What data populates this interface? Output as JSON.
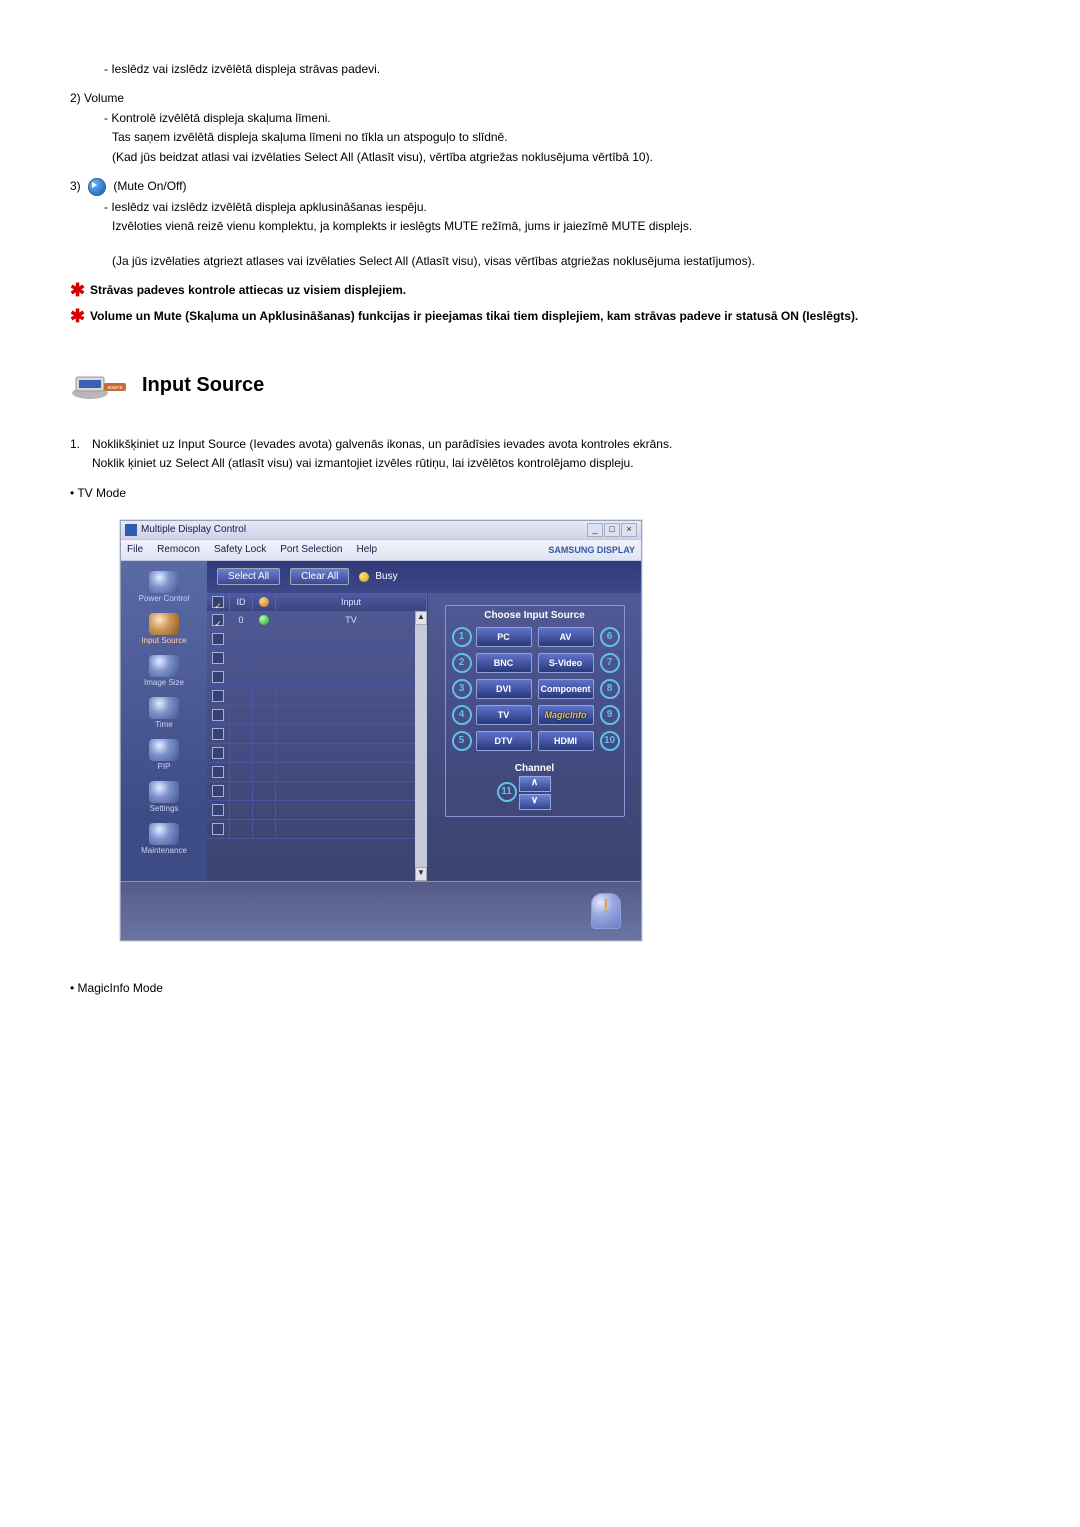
{
  "intro": {
    "power_sub": "- Ieslēdz vai izslēdz izvēlētā displeja strāvas padevi.",
    "item2_num": "2)",
    "item2_label": "Volume",
    "item2_l1": "- Kontrolē izvēlētā displeja skaļuma līmeni.",
    "item2_l2": "Tas saņem izvēlētā displeja skaļuma līmeni no tīkla un atspoguļo to slīdnē.",
    "item2_l3": "(Kad jūs beidzat atlasi vai izvēlaties Select All (Atlasīt visu), vērtība atgriežas noklusējuma vērtībā 10).",
    "item3_num": "3)",
    "item3_label": "(Mute On/Off)",
    "item3_l1": "- Ieslēdz vai izslēdz izvēlētā displeja apklusināšanas iespēju.",
    "item3_l2": "Izvēloties vienā reizē vienu komplektu, ja komplekts ir ieslēgts MUTE režīmā, jums ir jaiezīmē MUTE displejs.",
    "item3_l3": "(Ja jūs izvēlaties atgriezt atlases vai izvēlaties Select All (Atlasīt visu), visas vērtības atgriežas noklusējuma iestatījumos).",
    "star1": "Strāvas padeves kontrole attiecas uz visiem displejiem.",
    "star2": "Volume un Mute (Skaļuma un Apklusināšanas) funkcijas ir pieejamas tikai tiem displejiem, kam strāvas padeve ir statusā ON (Ieslēgts)."
  },
  "section": {
    "title": "Input Source",
    "step1_num": "1.",
    "step1_l1": "Noklikšķiniet uz Input Source (Ievades avota) galvenās ikonas, un parādīsies ievades avota kontroles ekrāns.",
    "step1_l2": "Noklik       ķiniet uz Select All (atlasīt visu) vai izmantojiet izvēles rūtiņu, lai izvēlētos kontrolējamo displeju.",
    "bullet1": "• TV Mode",
    "bullet2": "• MagicInfo Mode"
  },
  "mdc": {
    "title": "Multiple Display Control",
    "menu": {
      "file": "File",
      "remocon": "Remocon",
      "safety": "Safety Lock",
      "port": "Port Selection",
      "help": "Help"
    },
    "brand": "SAMSUNG DISPLAY",
    "sidebar": {
      "power": "Power Control",
      "input": "Input Source",
      "image": "Image Size",
      "time": "Time",
      "pip": "PIP",
      "settings": "Settings",
      "maint": "Maintenance"
    },
    "toolbar": {
      "select_all": "Select All",
      "clear_all": "Clear All",
      "busy": "Busy"
    },
    "grid": {
      "h_chk": "☑",
      "h_id": "ID",
      "h_pwr": "●",
      "h_input": "Input",
      "row0_id": "0",
      "row0_input": "TV"
    },
    "chooser": {
      "title": "Choose Input Source",
      "pc": "PC",
      "av": "AV",
      "bnc": "BNC",
      "svideo": "S-Video",
      "dvi": "DVI",
      "component": "Component",
      "tv": "TV",
      "magic": "MagicInfo",
      "dtv": "DTV",
      "hdmi": "HDMI",
      "channel": "Channel",
      "up": "∧",
      "down": "∨",
      "n1": "1",
      "n2": "2",
      "n3": "3",
      "n4": "4",
      "n5": "5",
      "n6": "6",
      "n7": "7",
      "n8": "8",
      "n9": "9",
      "n10": "10",
      "n11": "11"
    },
    "info": "!"
  }
}
